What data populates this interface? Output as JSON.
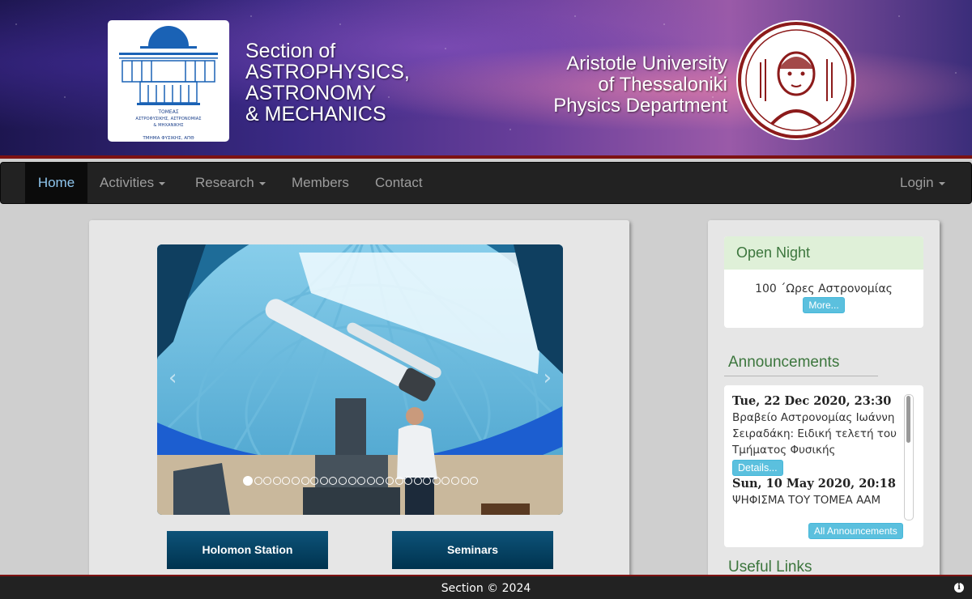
{
  "header": {
    "logo": {
      "text_line1": "ΤΟΜΕΑΣ",
      "text_line2": "ΑΣΤΡΟΦΥΣΙΚΗΣ, ΑΣΤΡΟΝΟΜΙΑΣ",
      "text_line3": "& ΜΗΧΑΝΙΚΗΣ",
      "text_line4": "ΤΜΗΜΑ ΦΥΣΙΚΗΣ, ΑΠΘ"
    },
    "section_line1": "Section of",
    "section_line2": "ASTROPHYSICS,",
    "section_line3": "ASTRONOMY",
    "section_line4": "& MECHANICS",
    "univ_line1": "Aristotle University",
    "univ_line2": "of Thessaloniki",
    "univ_line3": "Physics Department",
    "seal_icon": "aristotle-university-seal"
  },
  "nav": {
    "home": "Home",
    "activities": "Activities",
    "research": "Research",
    "members": "Members",
    "contact": "Contact",
    "login": "Login"
  },
  "main": {
    "carousel": {
      "slide_count": 25,
      "active_index": 0,
      "image": "telescope-observatory-photo"
    },
    "buttons": {
      "holomon": "Holomon Station",
      "seminars": "Seminars"
    }
  },
  "sidebar": {
    "open_night": {
      "title": "Open Night",
      "text": "100 ΄Ωρες Αστρονομίας",
      "more": "More..."
    },
    "announcements": {
      "title": "Announcements",
      "items": [
        {
          "date": "Tue, 22 Dec 2020, 23:30",
          "text": "Βραβείο Αστρονομίας Ιωάννη Σειραδάκη: Ειδική τελετή του Τμήματος Φυσικής",
          "details": "Details..."
        },
        {
          "date": "Sun, 10 May 2020, 20:18",
          "text": "ΨΗΦΙΣΜΑ ΤΟΥ ΤΟΜΕΑ ΑΑΜ"
        }
      ],
      "all": "All Announcements"
    },
    "useful_links": "Useful Links"
  },
  "footer": {
    "text": "Section © 2024",
    "info_icon": "info-icon"
  },
  "colors": {
    "navbar": "#222222",
    "accent_red": "#7d1212",
    "btn_blue": "#0d5379",
    "green_text": "#3c763d",
    "info": "#5bc0de"
  }
}
